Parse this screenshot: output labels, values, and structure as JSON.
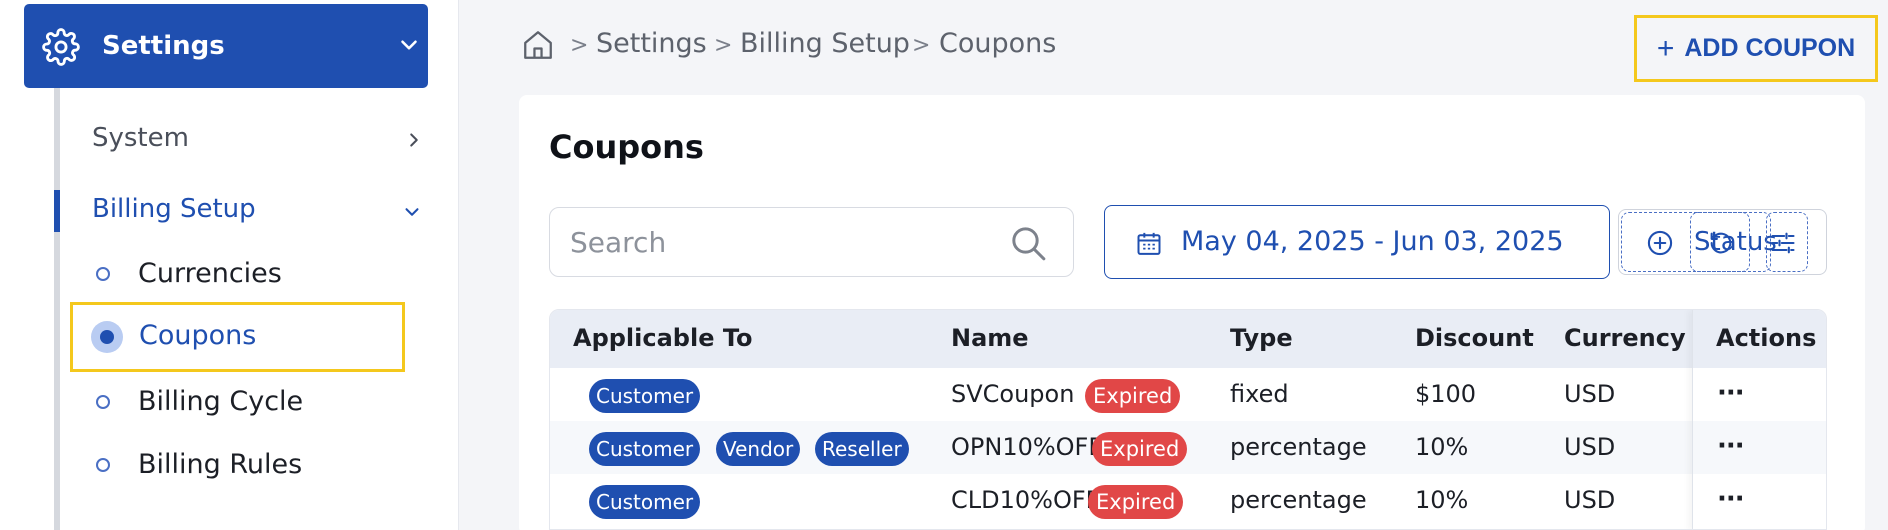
{
  "sidebar": {
    "header_label": "Settings",
    "items": [
      {
        "label": "System"
      },
      {
        "label": "Billing Setup"
      }
    ],
    "sub_items": [
      {
        "label": "Currencies"
      },
      {
        "label": "Coupons"
      },
      {
        "label": "Billing Cycle"
      },
      {
        "label": "Billing Rules"
      }
    ],
    "accent_color": "#1f4fb0",
    "highlight_color": "#f4c81d"
  },
  "breadcrumb": {
    "items": [
      "Settings",
      "Billing Setup",
      "Coupons"
    ],
    "separator": ">"
  },
  "toolbar": {
    "add_label": "ADD COUPON",
    "add_icon": "+"
  },
  "main": {
    "title": "Coupons",
    "search_placeholder": "Search",
    "date_range": "May 04, 2025 - Jun 03, 2025",
    "status_filter_label": "Status"
  },
  "table": {
    "headers": [
      "Applicable To",
      "Name",
      "Type",
      "Discount",
      "Currency",
      "Actions"
    ],
    "rows": [
      {
        "applicable_to": [
          "Customer"
        ],
        "name": "SVCoupon",
        "status": "Expired",
        "type": "fixed",
        "discount": "$100",
        "currency": "USD",
        "actions": "···"
      },
      {
        "applicable_to": [
          "Customer",
          "Vendor",
          "Reseller"
        ],
        "name": "OPN10%OFF",
        "status": "Expired",
        "type": "percentage",
        "discount": "10%",
        "currency": "USD",
        "actions": "···"
      },
      {
        "applicable_to": [
          "Customer"
        ],
        "name": "CLD10%OFF",
        "status": "Expired",
        "type": "percentage",
        "discount": "10%",
        "currency": "USD",
        "actions": "···"
      }
    ]
  }
}
